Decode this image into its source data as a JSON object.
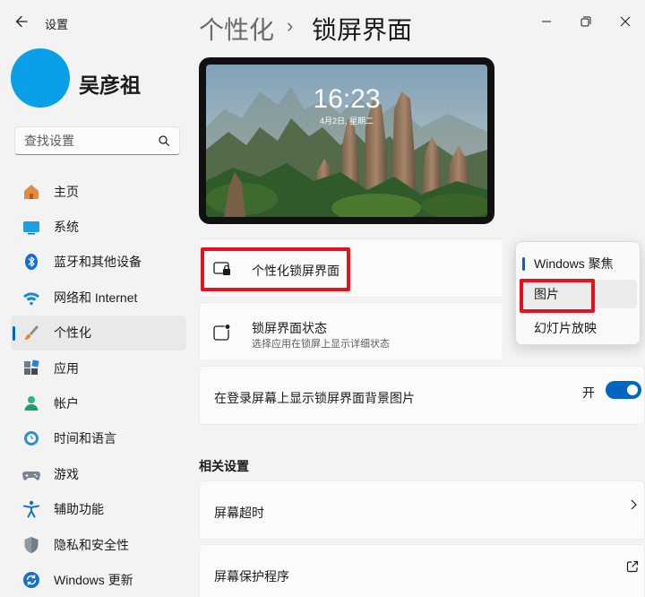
{
  "window": {
    "app_title": "设置",
    "back_icon": "arrow-left-icon",
    "controls": [
      "minimize-icon",
      "maximize-icon",
      "close-icon"
    ]
  },
  "user": {
    "name": "吴彦祖",
    "avatar_color": "#0aa0e8"
  },
  "search": {
    "placeholder": "查找设置",
    "icon": "search-icon"
  },
  "sidebar": {
    "items": [
      {
        "label": "主页",
        "icon": "home-icon"
      },
      {
        "label": "系统",
        "icon": "system-icon"
      },
      {
        "label": "蓝牙和其他设备",
        "icon": "bluetooth-icon"
      },
      {
        "label": "网络和 Internet",
        "icon": "wifi-icon"
      },
      {
        "label": "个性化",
        "icon": "brush-icon",
        "active": true
      },
      {
        "label": "应用",
        "icon": "apps-icon"
      },
      {
        "label": "帐户",
        "icon": "account-icon"
      },
      {
        "label": "时间和语言",
        "icon": "time-language-icon"
      },
      {
        "label": "游戏",
        "icon": "gamepad-icon"
      },
      {
        "label": "辅助功能",
        "icon": "accessibility-icon"
      },
      {
        "label": "隐私和安全性",
        "icon": "shield-icon"
      },
      {
        "label": "Windows 更新",
        "icon": "update-icon"
      }
    ]
  },
  "breadcrumb": {
    "parent": "个性化",
    "separator": "›",
    "current": "锁屏界面"
  },
  "preview": {
    "time": "16:23",
    "date": "4月2日, 星期二"
  },
  "settings": {
    "personalize_lock": {
      "title": "个性化锁屏界面",
      "icon": "lock-screen-icon"
    },
    "lock_status": {
      "title": "锁屏界面状态",
      "subtitle": "选择应用在锁屏上显示详细状态",
      "icon": "status-icon"
    },
    "login_background": {
      "title": "在登录屏幕上显示锁屏界面背景图片",
      "toggle_label": "开",
      "toggle_on": true
    }
  },
  "related": {
    "heading": "相关设置",
    "items": [
      {
        "title": "屏幕超时",
        "icon": "chevron-right-icon"
      },
      {
        "title": "屏幕保护程序",
        "icon": "external-link-icon"
      }
    ]
  },
  "dropdown": {
    "options": [
      "Windows 聚焦",
      "图片",
      "幻灯片放映"
    ],
    "current": "Windows 聚焦",
    "hovered": "图片"
  },
  "colors": {
    "accent": "#0067c0",
    "highlight": "#e8101c"
  }
}
